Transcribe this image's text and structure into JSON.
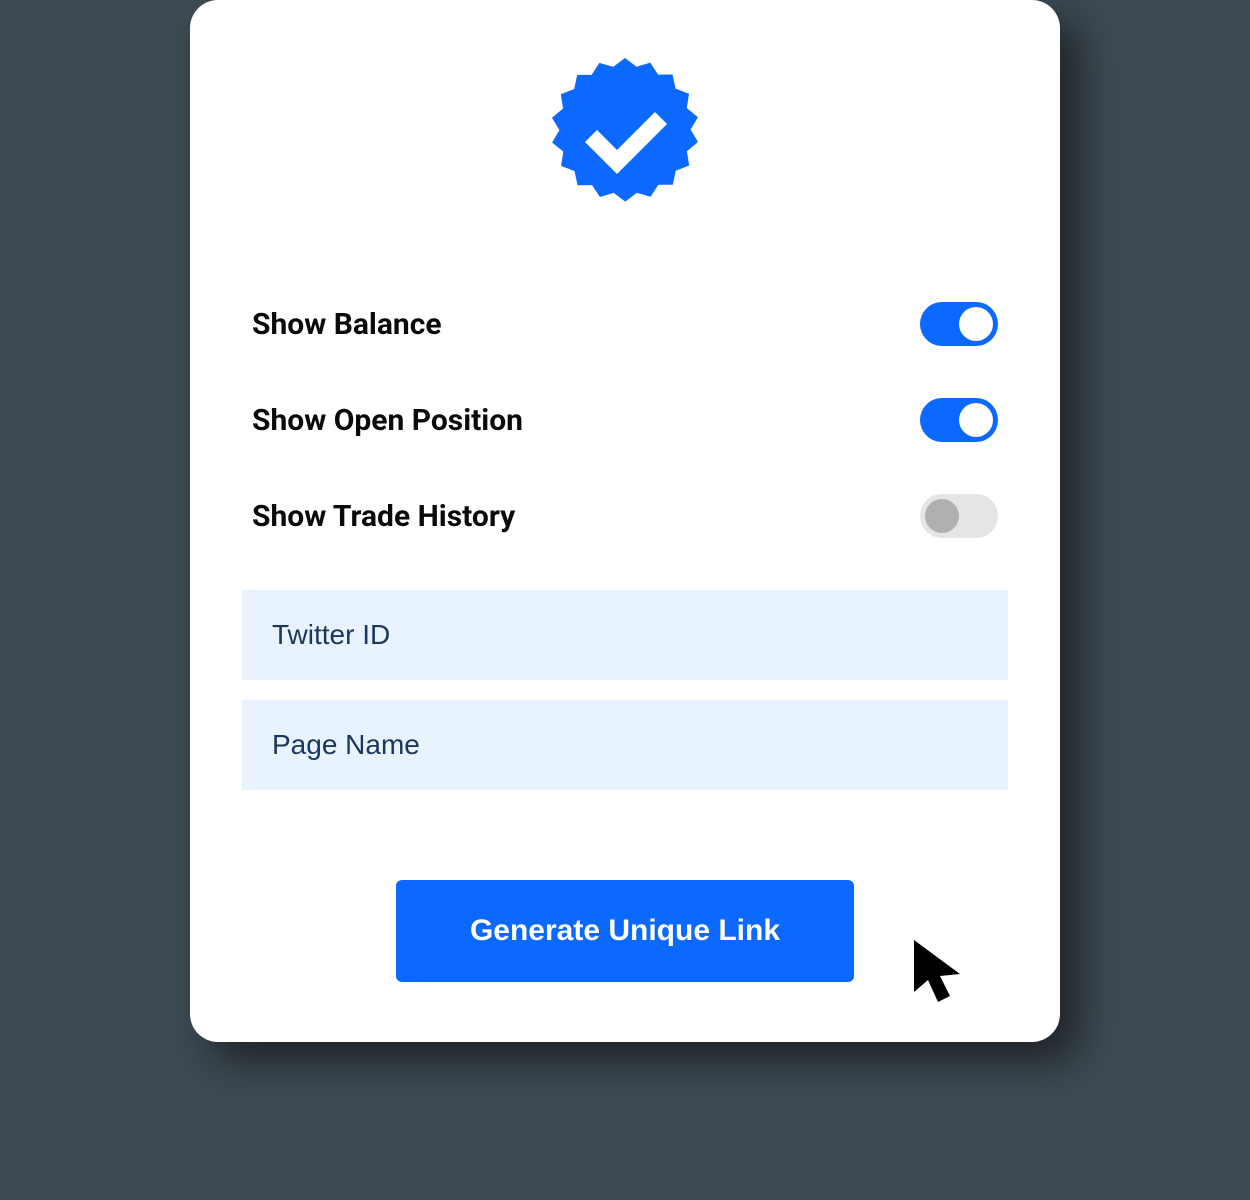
{
  "colors": {
    "accent": "#0b69ff",
    "input_bg": "#e9f2ff",
    "input_text": "#1a365d",
    "toggle_off_bg": "#e5e5e5",
    "toggle_off_knob": "#b0b0b0"
  },
  "toggles": [
    {
      "label": "Show Balance",
      "state": "on"
    },
    {
      "label": "Show Open Position",
      "state": "on"
    },
    {
      "label": "Show Trade History",
      "state": "off"
    }
  ],
  "inputs": {
    "twitter_placeholder": "Twitter ID",
    "twitter_value": "",
    "page_name_placeholder": "Page Name",
    "page_name_value": ""
  },
  "button": {
    "label": "Generate Unique Link"
  },
  "icons": {
    "badge": "verified-badge-icon",
    "cursor": "cursor-icon"
  }
}
